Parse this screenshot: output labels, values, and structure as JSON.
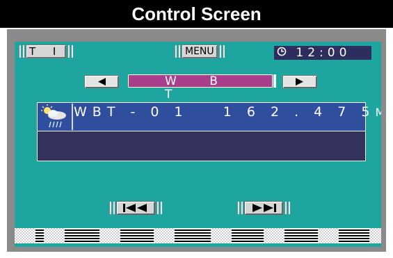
{
  "title": "Control Screen",
  "top_bar": {
    "ti_label": "T I",
    "menu_label": "MENU",
    "clock_time": "12:00"
  },
  "band": {
    "prev_icon": "left-triangle-icon",
    "label": "W B T",
    "next_icon": "right-triangle-icon"
  },
  "channel": {
    "weather_icon": "weather-sun-cloud-rain-icon",
    "station": "WBT - 0 1",
    "frequency": "1 6 2 . 4 7 5",
    "unit": "MHz"
  },
  "controls": {
    "rewind_icon": "skip-back-icon",
    "forward_icon": "skip-forward-icon"
  },
  "colors": {
    "screen_bg": "#1ea5a0",
    "band_bg": "#a83e8c",
    "channel_bg": "#2f4e9e",
    "info_bg": "#33335e",
    "clock_bg": "#2e2e5e"
  }
}
